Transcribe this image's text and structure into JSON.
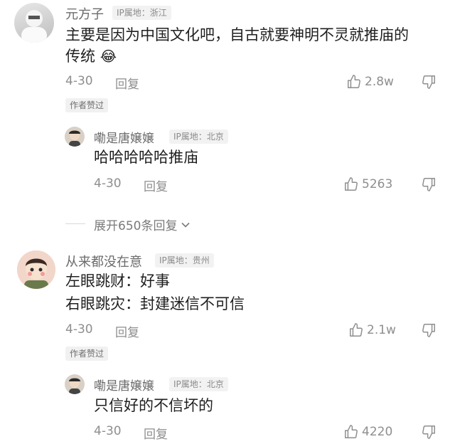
{
  "comments": [
    {
      "username": "元方子",
      "ip_label": "IP属地：浙江",
      "text_line1": "主要是因为中国文化吧，自古就要神明不灵就推庙的",
      "text_line2": "传统",
      "emoji": "😂",
      "date": "4-30",
      "reply_label": "回复",
      "likes": "2.8w",
      "author_badge": "作者赞过",
      "reply": {
        "username": "嘞是唐嬢嬢",
        "ip_label": "IP属地：北京",
        "text": "哈哈哈哈哈推庙",
        "date": "4-30",
        "reply_label": "回复",
        "likes": "5263"
      },
      "expand_label": "展开650条回复"
    },
    {
      "username": "从来都没在意",
      "ip_label": "IP属地：贵州",
      "text_line1": "左眼跳财：好事",
      "text_line2": "右眼跳灾：封建迷信不可信",
      "date": "4-30",
      "reply_label": "回复",
      "likes": "2.1w",
      "author_badge": "作者赞过",
      "reply": {
        "username": "嘞是唐嬢嬢",
        "ip_label": "IP属地：北京",
        "text": "只信好的不信坏的",
        "date": "4-30",
        "reply_label": "回复",
        "likes": "4220"
      }
    }
  ],
  "icons": {
    "like": "thumb-up-outline-icon",
    "dislike": "thumb-down-outline-icon",
    "chevron": "chevron-down-icon"
  }
}
